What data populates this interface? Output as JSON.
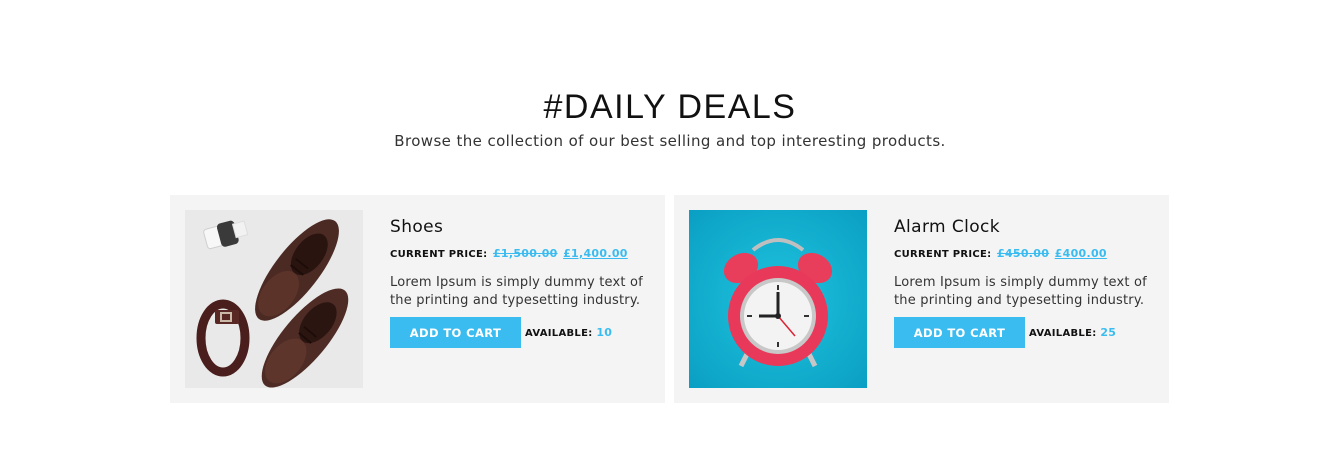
{
  "section": {
    "title": "#DAILY DEALS",
    "subtitle": "Browse the collection of our best selling and top interesting products."
  },
  "products": [
    {
      "name": "Shoes",
      "price_label": "CURRENT PRICE:",
      "old_price": "£1,500.00",
      "new_price": "£1,400.00",
      "description": "Lorem Ipsum is simply dummy text of the printing and typesetting industry.",
      "cta_label": "ADD TO CART",
      "available_label": "AVAILABLE:",
      "available_count": "10",
      "image_icon": "shoes-belt-photo"
    },
    {
      "name": "Alarm Clock",
      "price_label": "CURRENT PRICE:",
      "old_price": "£450.00",
      "new_price": "£400.00",
      "description": "Lorem Ipsum is simply dummy text of the printing and typesetting industry.",
      "cta_label": "ADD TO CART",
      "available_label": "AVAILABLE:",
      "available_count": "25",
      "image_icon": "alarm-clock-photo"
    }
  ],
  "colors": {
    "accent": "#3bbcf0",
    "card_bg": "#f4f4f4"
  }
}
